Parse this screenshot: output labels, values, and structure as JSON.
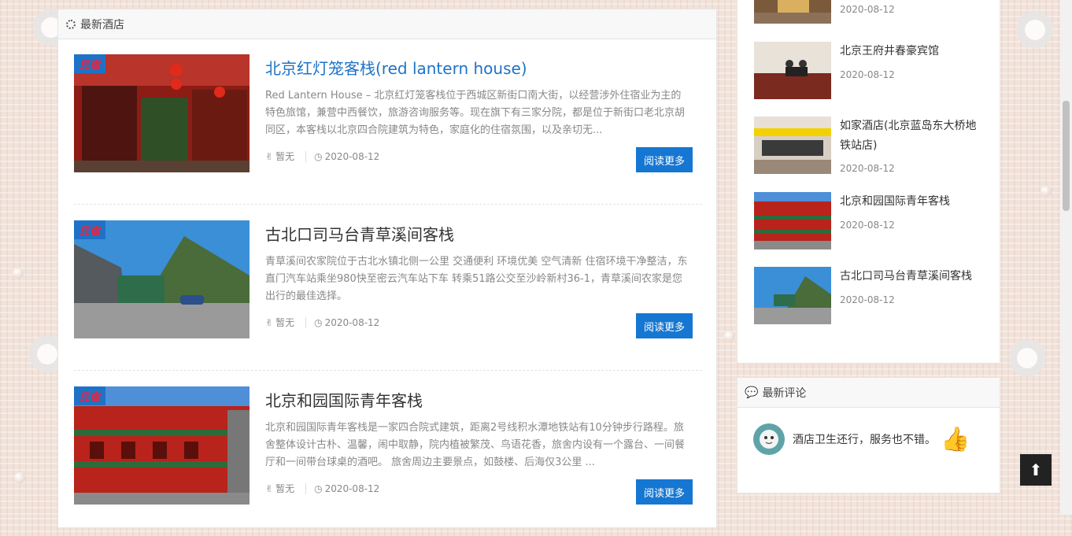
{
  "main": {
    "header": "最新酒店",
    "posts": [
      {
        "tag": "民宿",
        "title": "北京红灯笼客栈(red lantern house)",
        "excerpt": "Red Lantern House – 北京红灯笼客栈位于西城区新街口南大街，以经营涉外住宿业为主的特色旅馆，兼营中西餐饮，旅游咨询服务等。现在旗下有三家分院，都是位于新街口老北京胡同区，本客栈以北京四合院建筑为特色，家庭化的住宿氛围，以及亲切无...",
        "rating": "暂无",
        "date": "2020-08-12",
        "more": "阅读更多"
      },
      {
        "tag": "民宿",
        "title": "古北口司马台青草溪间客栈",
        "excerpt": "青草溪间农家院位于古北水镇北侧一公里 交通便利 环境优美 空气清新 住宿环境干净整洁，东直门汽车站乘坐980快至密云汽车站下车 转乘51路公交至沙岭新村36-1，青草溪间农家是您出行的最佳选择。",
        "rating": "暂无",
        "date": "2020-08-12",
        "more": "阅读更多"
      },
      {
        "tag": "民宿",
        "title": "北京和园国际青年客栈",
        "excerpt": "北京和园国际青年客栈是一家四合院式建筑，距离2号线积水潭地铁站有10分钟步行路程。旅舍整体设计古朴、温馨，闹中取静，院内植被繁茂、鸟语花香，旅舍内设有一个露台、一间餐厅和一间带台球桌的酒吧。 旅舍周边主要景点，如鼓楼、后海仅3公里 ...",
        "rating": "暂无",
        "date": "2020-08-12",
        "more": "阅读更多"
      }
    ]
  },
  "sidebar": {
    "items": [
      {
        "title": "",
        "date": "2020-08-12"
      },
      {
        "title": "北京王府井春豪宾馆",
        "date": "2020-08-12"
      },
      {
        "title": "如家酒店(北京蓝岛东大桥地铁站店)",
        "date": "2020-08-12"
      },
      {
        "title": "北京和园国际青年客栈",
        "date": "2020-08-12"
      },
      {
        "title": "古北口司马台青草溪间客栈",
        "date": "2020-08-12"
      }
    ],
    "comments_header": "最新评论",
    "comment": {
      "text": "酒店卫生还行，服务也不错。"
    }
  },
  "icons": {
    "spinner": "spinner-icon",
    "rating": "thumbs-icon",
    "clock": "clock-icon",
    "comment": "comment-icon",
    "back_to_top": "arrow-up-icon"
  },
  "colors": {
    "accent": "#1677d2",
    "link": "#1e73c8"
  }
}
